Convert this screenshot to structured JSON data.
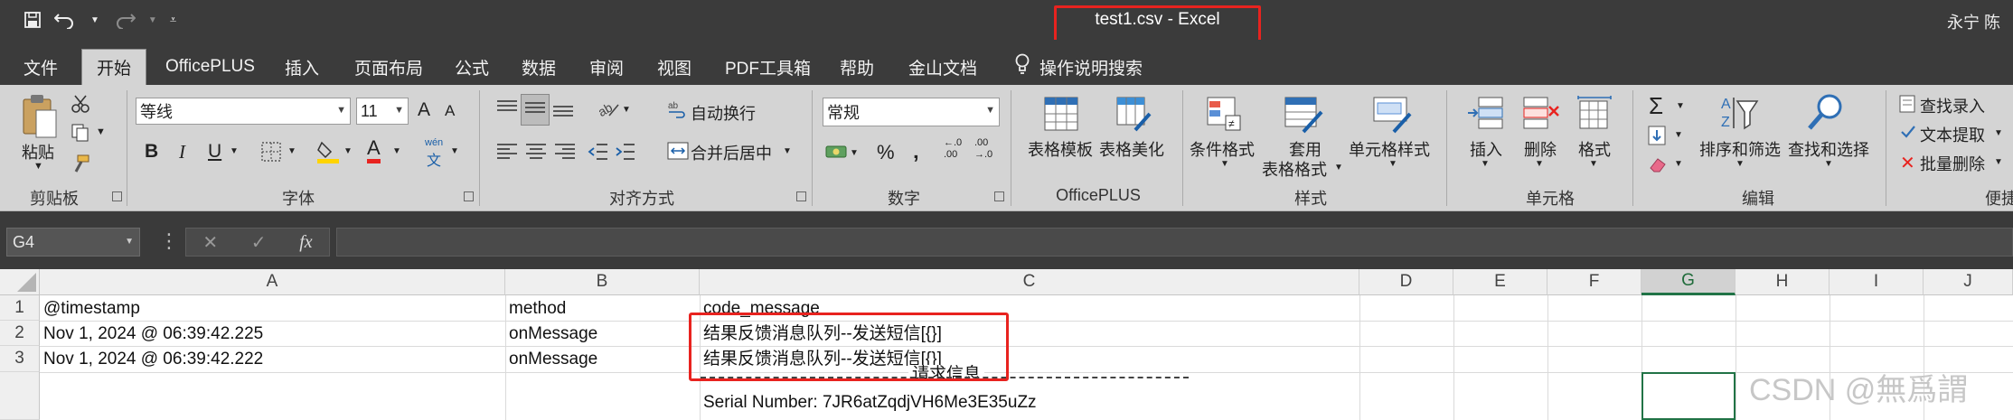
{
  "titlebar": {
    "title": "test1.csv  -  Excel",
    "user": "永宁 陈"
  },
  "tabs": [
    {
      "label": "文件"
    },
    {
      "label": "开始"
    },
    {
      "label": "OfficePLUS"
    },
    {
      "label": "插入"
    },
    {
      "label": "页面布局"
    },
    {
      "label": "公式"
    },
    {
      "label": "数据"
    },
    {
      "label": "审阅"
    },
    {
      "label": "视图"
    },
    {
      "label": "PDF工具箱"
    },
    {
      "label": "帮助"
    },
    {
      "label": "金山文档"
    }
  ],
  "tell_me": "操作说明搜索",
  "ribbon": {
    "clipboard": {
      "paste": "粘贴",
      "group": "剪贴板"
    },
    "font": {
      "name": "等线",
      "size": "11",
      "grow": "A",
      "shrink": "A",
      "bold": "B",
      "italic": "I",
      "underline": "U",
      "font_color_glyph": "A",
      "phonetic_top": "wén",
      "phonetic_bottom": "文",
      "group": "字体"
    },
    "alignment": {
      "wrap": "自动换行",
      "merge": "合并后居中",
      "group": "对齐方式"
    },
    "number": {
      "format": "常规",
      "percent": "%",
      "comma": "‚",
      "inc_top": "←.0",
      "inc_bottom": ".00",
      "dec_top": ".00",
      "dec_bottom": "→.0",
      "group": "数字"
    },
    "officeplus": {
      "templates": "表格模板",
      "beautify": "表格美化",
      "group": "OfficePLUS"
    },
    "styles": {
      "conditional": "条件格式",
      "as_table_1": "套用",
      "as_table_2": "表格格式",
      "cell_styles": "单元格样式",
      "group": "样式"
    },
    "cells": {
      "insert": "插入",
      "delete": "删除",
      "format": "格式",
      "group": "单元格"
    },
    "editing": {
      "sigma": "Σ",
      "sort_filter": "排序和筛选",
      "find_select": "查找和选择",
      "group": "编辑"
    },
    "extra": {
      "find_entry": "查找录入",
      "text_extract": "文本提取",
      "batch_delete": "批量删除",
      "group": "便捷"
    }
  },
  "formula_bar": {
    "name_box": "G4",
    "cancel": "✕",
    "enter": "✓",
    "fx": "fx",
    "value": ""
  },
  "sheet": {
    "columns": [
      "A",
      "B",
      "C",
      "D",
      "E",
      "F",
      "G",
      "H",
      "I",
      "J"
    ],
    "selected_column": "G",
    "rows": [
      "1",
      "2",
      "3"
    ],
    "cells": {
      "A1": "@timestamp",
      "B1": "method",
      "C1": "code_message",
      "A2": "Nov 1, 2024 @ 06:39:42.225",
      "B2": "onMessage",
      "C2": "结果反馈消息队列--发送短信[{}]",
      "A3": "Nov 1, 2024 @ 06:39:42.222",
      "B3": "onMessage",
      "C3": "结果反馈消息队列--发送短信[{}]"
    },
    "overflow_heading": "请求信息",
    "serial_line": "Serial Number: 7JR6atZqdjVH6Me3E35uZz"
  },
  "watermark": "CSDN @無爲謂",
  "colors": {
    "titlebar_bg": "#3b3b3b",
    "ribbon_bg": "#d4d4d4",
    "annotation_red": "#e8231f",
    "excel_green": "#217346"
  }
}
